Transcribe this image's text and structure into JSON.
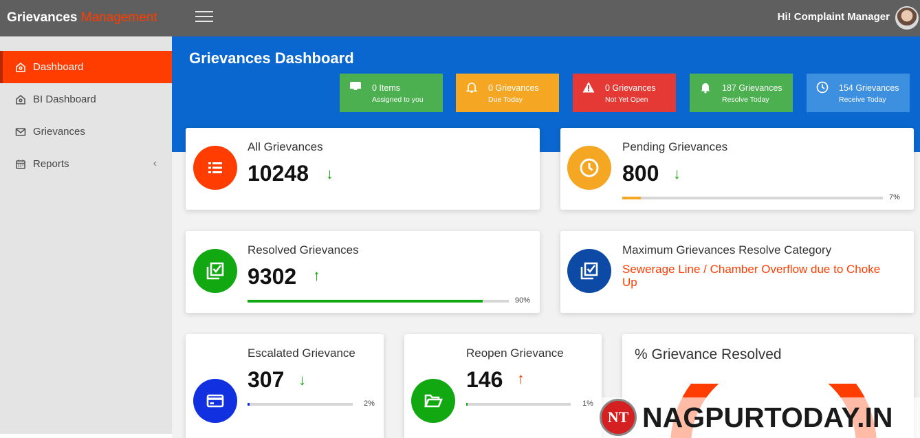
{
  "header": {
    "brand_part1": "Grievances",
    "brand_part2": "Management",
    "greeting": "Hi! Complaint Manager"
  },
  "sidebar": {
    "items": [
      {
        "label": "Dashboard",
        "icon": "home-icon",
        "active": true
      },
      {
        "label": "BI Dashboard",
        "icon": "home-icon"
      },
      {
        "label": "Grievances",
        "icon": "envelope-icon"
      },
      {
        "label": "Reports",
        "icon": "calendar-icon",
        "chevron": "‹"
      }
    ]
  },
  "dashboard": {
    "title": "Grievances Dashboard",
    "stats": [
      {
        "line1": "0 Items",
        "line2": "Assigned to you",
        "color": "#4caf50",
        "icon": "inbox-icon"
      },
      {
        "line1": "0 Grievances",
        "line2": "Due Today",
        "color": "#f5a623",
        "icon": "bell-icon"
      },
      {
        "line1": "0 Grievances",
        "line2": "Not Yet Open",
        "color": "#e53935",
        "icon": "warning-icon"
      },
      {
        "line1": "187 Grievances",
        "line2": "Resolve Today",
        "color": "#4caf50",
        "icon": "bell-icon"
      },
      {
        "line1": "154 Grievances",
        "line2": "Receive Today",
        "color": "#3d8fe0",
        "icon": "clock-icon"
      }
    ],
    "cards": {
      "all": {
        "label": "All Grievances",
        "value": "10248",
        "trend": "down",
        "color": "#ff3d00"
      },
      "pending": {
        "label": "Pending Grievances",
        "value": "800",
        "trend": "down",
        "percent": "7%",
        "fraction": 0.07,
        "color": "#f5a623"
      },
      "resolved": {
        "label": "Resolved Grievances",
        "value": "9302",
        "trend": "up",
        "percent": "90%",
        "fraction": 0.9,
        "color": "#11a811"
      },
      "max_category": {
        "label": "Maximum Grievances Resolve Category",
        "value": "Sewerage Line / Chamber Overflow due to Choke Up",
        "color": "#0c4aa6"
      },
      "escalated": {
        "label": "Escalated Grievance",
        "value": "307",
        "trend": "down",
        "percent": "2%",
        "fraction": 0.02,
        "color": "#1130e0"
      },
      "reopen": {
        "label": "Reopen Grievance",
        "value": "146",
        "trend": "up",
        "percent": "1%",
        "fraction": 0.01,
        "color": "#11a811"
      },
      "resolved_pct": {
        "label": "% Grievance Resolved"
      }
    }
  },
  "watermark": {
    "logo": "NT",
    "text": "NAGPURTODAY.IN"
  },
  "colors": {
    "accent": "#ff3d00",
    "header_blue": "#0a67cf",
    "up": "#ff3d00",
    "down": "#11a811"
  }
}
